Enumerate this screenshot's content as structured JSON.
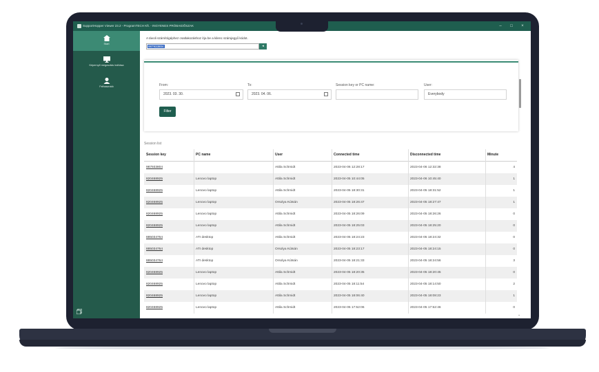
{
  "window": {
    "title": "SupportHopper Viewer 23.2 - ProgramTECH Kft. - INGYENES PRÓBAIDŐSZAK",
    "minimize": "–",
    "maximize": "□",
    "close": "×"
  },
  "sidebar": {
    "items": [
      {
        "label": "Start",
        "icon": "home-icon"
      },
      {
        "label": "Képernyő megosztás indítása",
        "icon": "monitor-icon"
      },
      {
        "label": "Felhasználó",
        "icon": "user-icon"
      }
    ]
  },
  "connect": {
    "prompt": "A távoli számítógéphez csatlakozáshoz írja be a kilenc számjegyű kódot.",
    "code": "987933804",
    "go": "◂"
  },
  "filter": {
    "from_label": "From:",
    "from_value": "2023. 03. 30.",
    "to_label": "To:",
    "to_value": "2023. 04. 06.",
    "key_label": "Session key or PC name:",
    "key_value": "",
    "user_label": "User:",
    "user_value": "Everybody",
    "button": "Filter"
  },
  "sessions": {
    "label": "Session list",
    "columns": [
      "Session key",
      "PC name",
      "User",
      "Connected time",
      "Disconnected time",
      "Minute"
    ],
    "rows": [
      [
        "987933804",
        "",
        "Attila Schmidt",
        "2023-04-06 12:28:17",
        "2023-04-06 12:32:38",
        "4"
      ],
      [
        "820468925",
        "Lenovo laptop",
        "Attila Schmidt",
        "2023-04-05 10:44:05",
        "2023-04-06 10:45:40",
        "1"
      ],
      [
        "820468925",
        "Lenovo laptop",
        "Attila Schmidt",
        "2023-04-05 18:30:31",
        "2023-04-05 18:31:52",
        "1"
      ],
      [
        "820468925",
        "Lenovo laptop",
        "Orsolya Kútsán",
        "2023-04-05 18:26:47",
        "2023-04-05 18:27:47",
        "1"
      ],
      [
        "820468925",
        "Lenovo laptop",
        "Attila Schmidt",
        "2023-04-05 18:26:09",
        "2023-04-05 18:26:26",
        "0"
      ],
      [
        "820468925",
        "Lenovo laptop",
        "Attila Schmidt",
        "2023-04-05 18:25:03",
        "2023-04-05 18:25:20",
        "0"
      ],
      [
        "885034764",
        "ATI desktop",
        "Attila Schmidt",
        "2023-04-05 18:24:23",
        "2023-04-05 18:24:32",
        "0"
      ],
      [
        "885034764",
        "ATI desktop",
        "Orsolya Kútsán",
        "2023-04-05 18:23:17",
        "2023-04-05 18:24:15",
        "0"
      ],
      [
        "885034764",
        "ATI desktop",
        "Orsolya Kútsán",
        "2023-04-05 18:21:33",
        "2023-04-05 18:24:56",
        "3"
      ],
      [
        "820468925",
        "Lenovo laptop",
        "Attila Schmidt",
        "2023-04-05 18:20:35",
        "2023-04-05 18:20:45",
        "0"
      ],
      [
        "820468925",
        "Lenovo laptop",
        "Attila Schmidt",
        "2023-04-05 18:11:54",
        "2023-04-05 18:14:50",
        "2"
      ],
      [
        "820468925",
        "Lenovo laptop",
        "Attila Schmidt",
        "2023-04-05 18:06:40",
        "2023-04-05 18:08:23",
        "1"
      ],
      [
        "820468925",
        "Lenovo laptop",
        "Attila Schmidt",
        "2023-04-05 17:52:06",
        "2023-04-05 17:52:46",
        "0"
      ]
    ]
  }
}
